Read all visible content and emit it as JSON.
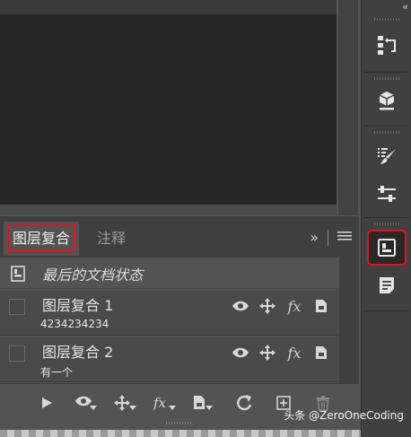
{
  "panel": {
    "tabs": [
      {
        "label": "图层复合"
      },
      {
        "label": "注释"
      }
    ],
    "expand_label": "»",
    "last_state_label": "最后的文档状态",
    "comps": [
      {
        "name": "图层复合 1",
        "comment": "4234234234"
      },
      {
        "name": "图层复合 2",
        "comment": "有一个"
      }
    ]
  },
  "dock": {
    "collapse_label": "‹‹"
  },
  "watermark": "头条 @ZeroOneCoding",
  "colors": {
    "highlight": "#e0141e",
    "panel_bg": "#535353",
    "row_bg": "#4a4a4a"
  }
}
